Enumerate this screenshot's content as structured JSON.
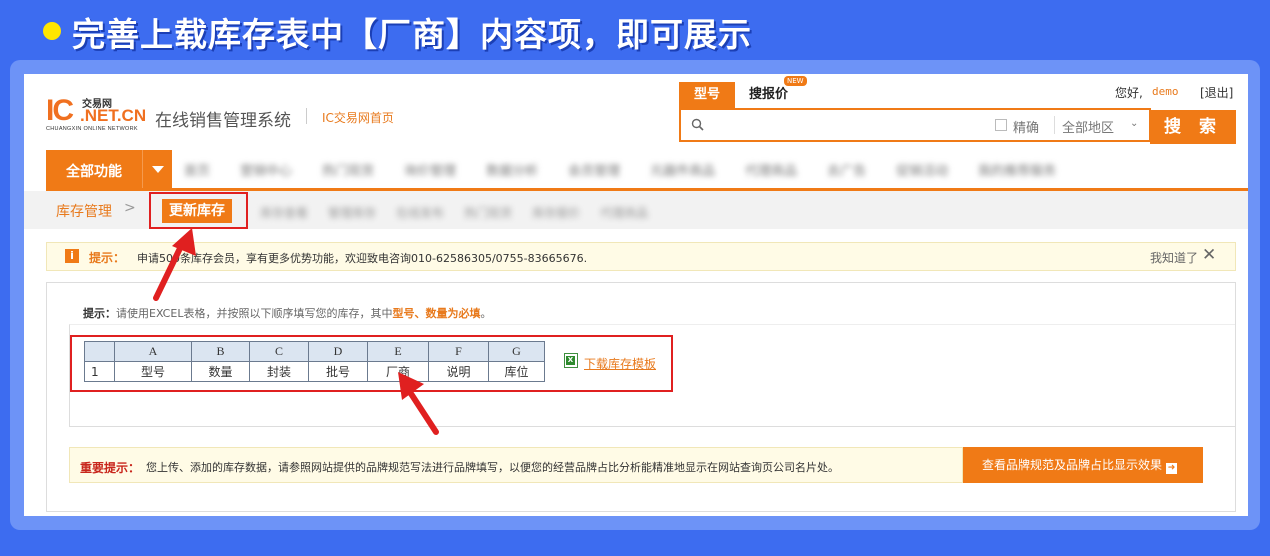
{
  "banner": {
    "text": "完善上载库存表中【厂商】内容项，即可展示"
  },
  "header": {
    "logo_ic": "IC",
    "logo_cn": "交易网",
    "logo_net": ".NET.CN",
    "logo_en": "CHUANGXIN ONLINE NETWORK",
    "system_title": "在线销售管理系统",
    "home_link": "IC交易网首页",
    "greeting": "您好,",
    "username": "demo",
    "logout": "[退出]"
  },
  "search": {
    "tab_model": "型号",
    "tab_quote": "搜报价",
    "new_badge": "NEW",
    "placeholder": "",
    "exact_label": "精确",
    "region_label": "全部地区",
    "button_label": "搜 索"
  },
  "nav": {
    "all_functions": "全部功能",
    "items": [
      "首页",
      "营销中心",
      "热门现货",
      "询价管理",
      "数据分析",
      "会员管理",
      "元器件商品",
      "代理商品",
      "去广告",
      "促销活动",
      "我的推荐服务"
    ]
  },
  "subnav": {
    "crumb": "库存管理",
    "crumb_sep": ">",
    "active": "更新库存",
    "items": [
      "库存查看",
      "管理库存",
      "在线发布",
      "热门现货",
      "库存报价",
      "代理商品"
    ]
  },
  "tip": {
    "label": "提示：",
    "text": "申请500条库存会员，享有更多优势功能，欢迎致电咨询010-62586305/0755-83665676.",
    "dismiss": "我知道了"
  },
  "upload": {
    "hint_label": "提示：",
    "hint_text": "请使用EXCEL表格，并按照以下顺序填写您的库存，其中",
    "hint_required": "型号、数量为必填",
    "hint_end": "。",
    "columns": [
      "A",
      "B",
      "C",
      "D",
      "E",
      "F",
      "G"
    ],
    "row_number": "1",
    "fields": [
      "型号",
      "数量",
      "封装",
      "批号",
      "厂商",
      "说明",
      "库位"
    ],
    "download_link": "下载库存模板"
  },
  "important": {
    "label": "重要提示：",
    "text": "您上传、添加的库存数据，请参照网站提供的品牌规范写法进行品牌填写，以便您的经营品牌占比分析能精准地显示在网站查询页公司名片处。",
    "button": "查看品牌规范及品牌占比显示效果"
  },
  "colors": {
    "accent": "#f07a16",
    "annotation_red": "#e02020",
    "background": "#3d6cf0"
  }
}
